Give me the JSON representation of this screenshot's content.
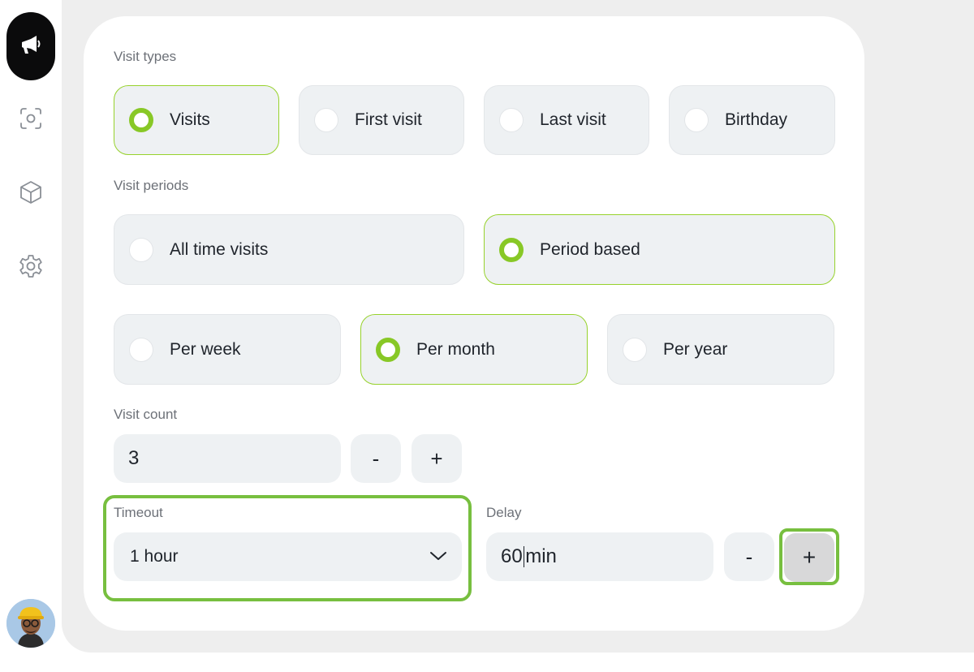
{
  "sidebar": {
    "items": [
      {
        "icon": "megaphone-icon",
        "active": true
      },
      {
        "icon": "scan-icon"
      },
      {
        "icon": "cube-icon"
      },
      {
        "icon": "gear-icon"
      }
    ],
    "avatar": "avatar"
  },
  "visit_types": {
    "label": "Visit types",
    "options": [
      {
        "label": "Visits",
        "selected": true
      },
      {
        "label": "First visit",
        "selected": false
      },
      {
        "label": "Last visit",
        "selected": false
      },
      {
        "label": "Birthday",
        "selected": false
      }
    ]
  },
  "visit_periods": {
    "label": "Visit periods",
    "options": [
      {
        "label": "All time visits",
        "selected": false
      },
      {
        "label": "Period based",
        "selected": true
      }
    ],
    "period_options": [
      {
        "label": "Per week",
        "selected": false
      },
      {
        "label": "Per month",
        "selected": true
      },
      {
        "label": "Per year",
        "selected": false
      }
    ]
  },
  "visit_count": {
    "label": "Visit count",
    "value": "3",
    "minus_label": "-",
    "plus_label": "+"
  },
  "timeout": {
    "label": "Timeout",
    "value": "1 hour"
  },
  "delay": {
    "label": "Delay",
    "value": "60",
    "unit": "min",
    "minus_label": "-",
    "plus_label": "+"
  },
  "colors": {
    "accent": "#88c826",
    "highlight": "#77bf3f",
    "field_bg": "#eef1f3"
  }
}
